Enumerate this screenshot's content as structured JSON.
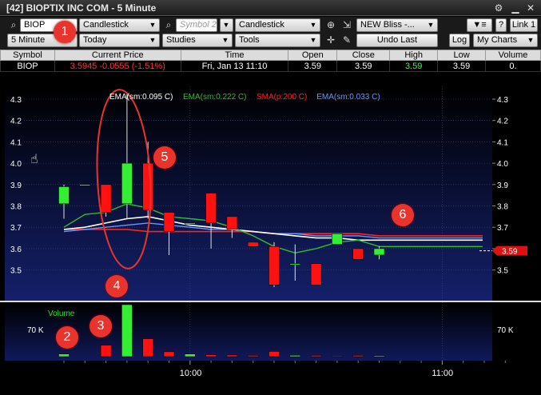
{
  "window": {
    "title": "[42] BIOPTIX INC COM - 5 Minute",
    "gear_icon": "gear-icon",
    "minimize_icon": "minimize-icon",
    "close_icon": "close-icon"
  },
  "toolbar1": {
    "symbol1_value": "BIOP",
    "chart_type1": "Candlestick",
    "symbol2_placeholder": "Symbol 2",
    "chart_type2": "Candlestick",
    "study_set": "NEW Bliss -...",
    "link_label": "Link 1",
    "help_label": "?"
  },
  "toolbar2": {
    "interval": "5 Minute",
    "range": "Today",
    "studies": "Studies",
    "tools": "Tools",
    "undo_last": "Undo Last",
    "log": "Log",
    "my_charts": "My Charts"
  },
  "quote": {
    "headers": [
      "Symbol",
      "Current Price",
      "Time",
      "Open",
      "Close",
      "High",
      "Low",
      "Volume"
    ],
    "row": {
      "symbol": "BIOP",
      "current_price": "3.5945  -0.0555 (-1.51%)",
      "time": "Fri, Jan 13  11:10",
      "open": "3.59",
      "close": "3.59",
      "high": "3.59",
      "low": "3.59",
      "volume": "0."
    }
  },
  "colors": {
    "up_candle": "#33ee33",
    "down_candle": "#ff1111",
    "ema_slow": "#ffffff",
    "ema_green": "#33bb33",
    "sma_200": "#ff2222",
    "ema_fast": "#6699ff",
    "plot_bg_top": "#000000",
    "plot_bg_bottom": "#14206a"
  },
  "chart_data": {
    "type": "candlestick",
    "legend": [
      {
        "label": "EMA(sm:0.095 C)",
        "color": "#ffffff"
      },
      {
        "label": "EMA(sm:0.222 C)",
        "color": "#33bb33"
      },
      {
        "label": "SMA(p:200 C)",
        "color": "#ff2222"
      },
      {
        "label": "EMA(sm:0.033 C)",
        "color": "#6699ff"
      }
    ],
    "y_ticks": [
      "4.3",
      "4.2",
      "4.1",
      "4.0",
      "3.9",
      "3.8",
      "3.7",
      "3.6",
      "3.5"
    ],
    "ylim": [
      3.42,
      4.33
    ],
    "x_ticks": [
      "10:00",
      "11:00"
    ],
    "last_price_label": "3.59",
    "candles": [
      {
        "t": 0,
        "open": 3.81,
        "close": 3.89,
        "high": 3.9,
        "low": 3.74
      },
      {
        "t": 1,
        "open": 3.9,
        "close": 3.9,
        "high": 3.9,
        "low": 3.9
      },
      {
        "t": 2,
        "open": 3.9,
        "close": 3.77,
        "high": 3.9,
        "low": 3.75
      },
      {
        "t": 3,
        "open": 3.81,
        "close": 4.0,
        "high": 4.33,
        "low": 3.74
      },
      {
        "t": 4,
        "open": 4.0,
        "close": 3.78,
        "high": 4.1,
        "low": 3.74
      },
      {
        "t": 5,
        "open": 3.77,
        "close": 3.68,
        "high": 3.77,
        "low": 3.57
      },
      {
        "t": 6,
        "open": 3.72,
        "close": 3.72,
        "high": 3.72,
        "low": 3.72
      },
      {
        "t": 7,
        "open": 3.86,
        "close": 3.72,
        "high": 3.86,
        "low": 3.6
      },
      {
        "t": 8,
        "open": 3.75,
        "close": 3.69,
        "high": 3.75,
        "low": 3.65
      },
      {
        "t": 9,
        "open": 3.63,
        "close": 3.61,
        "high": 3.63,
        "low": 3.61
      },
      {
        "t": 10,
        "open": 3.61,
        "close": 3.43,
        "high": 3.63,
        "low": 3.42
      },
      {
        "t": 11,
        "open": 3.53,
        "close": 3.53,
        "high": 3.62,
        "low": 3.45
      },
      {
        "t": 12,
        "open": 3.53,
        "close": 3.43,
        "high": 3.53,
        "low": 3.43
      },
      {
        "t": 13,
        "open": 3.62,
        "close": 3.67,
        "high": 3.67,
        "low": 3.62
      },
      {
        "t": 14,
        "open": 3.6,
        "close": 3.55,
        "high": 3.6,
        "low": 3.55
      },
      {
        "t": 15,
        "open": 3.57,
        "close": 3.6,
        "high": 3.61,
        "low": 3.55
      }
    ],
    "ema_slow": [
      3.69,
      3.7,
      3.72,
      3.74,
      3.75,
      3.73,
      3.71,
      3.7,
      3.69,
      3.68,
      3.67,
      3.66,
      3.65,
      3.65,
      3.64,
      3.64
    ],
    "ema_green": [
      3.7,
      3.76,
      3.77,
      3.81,
      3.79,
      3.75,
      3.74,
      3.73,
      3.7,
      3.66,
      3.61,
      3.58,
      3.6,
      3.63,
      3.64,
      3.61
    ],
    "sma_200": [
      3.69,
      3.69,
      3.69,
      3.69,
      3.68,
      3.68,
      3.68,
      3.68,
      3.68,
      3.68,
      3.67,
      3.67,
      3.67,
      3.67,
      3.67,
      3.66
    ],
    "ema_fast": [
      3.68,
      3.69,
      3.7,
      3.71,
      3.72,
      3.71,
      3.7,
      3.69,
      3.69,
      3.68,
      3.67,
      3.67,
      3.66,
      3.66,
      3.66,
      3.65
    ],
    "volume_label": "Volume",
    "volume_tick": "70 K",
    "volume_max": 160,
    "volume": [
      8,
      0,
      35,
      165,
      55,
      15,
      8,
      6,
      5,
      4,
      16,
      4,
      4,
      2,
      4,
      3
    ]
  },
  "annotations": [
    "1",
    "2",
    "3",
    "4",
    "5",
    "6"
  ]
}
